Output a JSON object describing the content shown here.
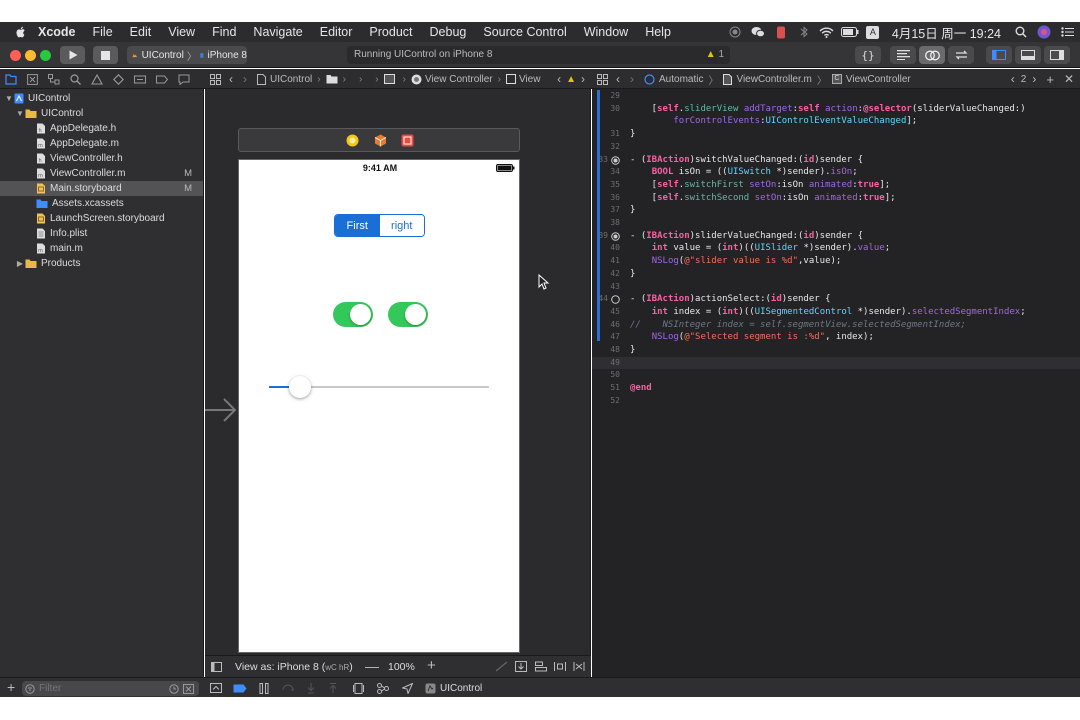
{
  "menubar": {
    "app_name": "Xcode",
    "items": [
      "File",
      "Edit",
      "View",
      "Find",
      "Navigate",
      "Editor",
      "Product",
      "Debug",
      "Source Control",
      "Window",
      "Help"
    ],
    "input_badge": "A",
    "clock": "4月15日 周一 19:24"
  },
  "toolbar": {
    "scheme_project": "UIControl",
    "scheme_device": "iPhone 8",
    "activity_text": "Running UIControl on iPhone 8",
    "warning_count": "1"
  },
  "canvas_tabbar": {
    "breadcrumb": [
      "UIControl",
      "View Controller",
      "View"
    ]
  },
  "editor_tabbar": {
    "mode": "Automatic",
    "file": "ViewController.m",
    "symbol": "ViewController",
    "counterpart_count": "2"
  },
  "navigator": {
    "items": [
      {
        "label": "UIControl",
        "level": 0,
        "type": "project",
        "disclosure": "open",
        "badge": ""
      },
      {
        "label": "UIControl",
        "level": 1,
        "type": "folder",
        "disclosure": "open",
        "badge": ""
      },
      {
        "label": "AppDelegate.h",
        "level": 2,
        "type": "h",
        "disclosure": "",
        "badge": ""
      },
      {
        "label": "AppDelegate.m",
        "level": 2,
        "type": "m",
        "disclosure": "",
        "badge": ""
      },
      {
        "label": "ViewController.h",
        "level": 2,
        "type": "h",
        "disclosure": "",
        "badge": ""
      },
      {
        "label": "ViewController.m",
        "level": 2,
        "type": "m",
        "disclosure": "",
        "badge": "M"
      },
      {
        "label": "Main.storyboard",
        "level": 2,
        "type": "storyboard",
        "disclosure": "",
        "badge": "M",
        "selected": true
      },
      {
        "label": "Assets.xcassets",
        "level": 2,
        "type": "assets",
        "disclosure": "",
        "badge": ""
      },
      {
        "label": "LaunchScreen.storyboard",
        "level": 2,
        "type": "storyboard",
        "disclosure": "",
        "badge": ""
      },
      {
        "label": "Info.plist",
        "level": 2,
        "type": "plist",
        "disclosure": "",
        "badge": ""
      },
      {
        "label": "main.m",
        "level": 2,
        "type": "m",
        "disclosure": "",
        "badge": ""
      },
      {
        "label": "Products",
        "level": 1,
        "type": "folder",
        "disclosure": "closed",
        "badge": ""
      }
    ],
    "filter_placeholder": "Filter"
  },
  "phone": {
    "time": "9:41 AM",
    "segments": [
      "First",
      "right"
    ],
    "selected_segment": 0,
    "switch_first_on": true,
    "switch_second_on": true,
    "slider_value": 0.14
  },
  "canvas_bottom": {
    "view_as": "View as: iPhone 8 (",
    "view_as_traits": "wC hR",
    "view_as_end": ")",
    "zoom": "100%"
  },
  "bottombar": {
    "target": "UIControl"
  },
  "code_lines": [
    {
      "n": "29",
      "html": ""
    },
    {
      "n": "30",
      "html": "    [<span class=\"kw\">self</span>.<span class=\"fn\">sliderView</span> <span class=\"mt\">addTarget</span>:<span class=\"kw\">self</span> <span class=\"mt\">action</span>:<span class=\"kw\">@selector</span>(sliderValueChanged:)"
    },
    {
      "n": "",
      "html": "        <span class=\"mt\">forControlEvents</span>:<span class=\"ty\">UIControlEventValueChanged</span>];"
    },
    {
      "n": "31",
      "html": "}"
    },
    {
      "n": "32",
      "html": ""
    },
    {
      "n": "33",
      "html": "- (<span class=\"kw\">IBAction</span>)switchValueChanged:(<span class=\"kw\">id</span>)sender {",
      "marker": "filled"
    },
    {
      "n": "34",
      "html": "    <span class=\"kw\">BOOL</span> isOn = ((<span class=\"ty\">UISwitch</span> *)sender).<span class=\"mt\">isOn</span>;"
    },
    {
      "n": "35",
      "html": "    [<span class=\"kw\">self</span>.<span class=\"fn\">switchFirst</span> <span class=\"mt\">setOn</span>:isOn <span class=\"mt\">animated</span>:<span class=\"kw\">true</span>];"
    },
    {
      "n": "36",
      "html": "    [<span class=\"kw\">self</span>.<span class=\"fn\">switchSecond</span> <span class=\"mt\">setOn</span>:isOn <span class=\"mt\">animated</span>:<span class=\"kw\">true</span>];"
    },
    {
      "n": "37",
      "html": "}"
    },
    {
      "n": "38",
      "html": ""
    },
    {
      "n": "39",
      "html": "- (<span class=\"kw\">IBAction</span>)sliderValueChanged:(<span class=\"kw\">id</span>)sender {",
      "marker": "filled"
    },
    {
      "n": "40",
      "html": "    <span class=\"kw\">int</span> value = (<span class=\"kw\">int</span>)((<span class=\"ty\">UISlider</span> *)sender).<span class=\"mt\">value</span>;"
    },
    {
      "n": "41",
      "html": "    <span class=\"mt\">NSLog</span>(<span class=\"st\">@\"slider value is %d\"</span>,value);"
    },
    {
      "n": "42",
      "html": "}"
    },
    {
      "n": "43",
      "html": ""
    },
    {
      "n": "44",
      "html": "- (<span class=\"kw\">IBAction</span>)actionSelect:(<span class=\"kw\">id</span>)sender {",
      "marker": "empty"
    },
    {
      "n": "45",
      "html": "    <span class=\"kw\">int</span> index = (<span class=\"kw\">int</span>)((<span class=\"ty\">UISegmentedControl</span> *)sender).<span class=\"mt\">selectedSegmentIndex</span>;"
    },
    {
      "n": "46",
      "html": "<span class=\"cm\">//    NSInteger index = self.segmentView.selectedSegmentIndex;</span>"
    },
    {
      "n": "47",
      "html": "    <span class=\"mt\">NSLog</span>(<span class=\"st\">@\"Selected segment is :%d\"</span>, index);"
    },
    {
      "n": "48",
      "html": "}"
    },
    {
      "n": "49",
      "html": "",
      "current": true
    },
    {
      "n": "50",
      "html": ""
    },
    {
      "n": "51",
      "html": "<span class=\"kw\">@end</span>"
    },
    {
      "n": "52",
      "html": ""
    }
  ],
  "colors": {
    "accent": "#1a6fd6",
    "switch_on": "#34c759",
    "close": "#ff5f57",
    "minimize": "#febc2e",
    "zoom": "#28c840",
    "change_bar": "#2b6fd6"
  }
}
